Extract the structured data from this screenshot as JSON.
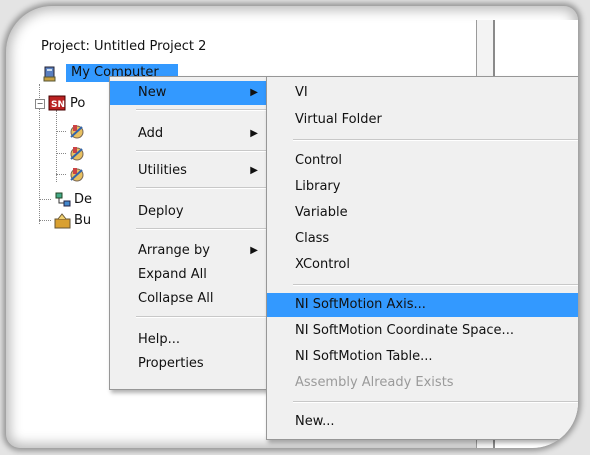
{
  "project": {
    "title": "Project: Untitled Project 2",
    "root_item": "My Computer",
    "child_items": [
      "Po",
      "De",
      "Bu"
    ]
  },
  "context_menu": {
    "items": [
      {
        "label": "New",
        "has_submenu": true,
        "highlighted": true
      },
      {
        "label": "Add",
        "has_submenu": true
      },
      {
        "label": "Utilities",
        "has_submenu": true
      },
      {
        "label": "Deploy",
        "has_submenu": false
      },
      {
        "label": "Arrange by",
        "has_submenu": true
      },
      {
        "label": "Expand All",
        "has_submenu": false
      },
      {
        "label": "Collapse All",
        "has_submenu": false
      },
      {
        "label": "Help...",
        "has_submenu": false
      },
      {
        "label": "Properties",
        "has_submenu": false
      }
    ]
  },
  "new_submenu": {
    "items": [
      {
        "label": "VI"
      },
      {
        "label": "Virtual Folder"
      },
      {
        "label": "Control"
      },
      {
        "label": "Library"
      },
      {
        "label": "Variable"
      },
      {
        "label": "Class"
      },
      {
        "label": "XControl"
      },
      {
        "label": "NI SoftMotion Axis...",
        "highlighted": true
      },
      {
        "label": "NI SoftMotion Coordinate Space..."
      },
      {
        "label": "NI SoftMotion Table..."
      },
      {
        "label": "Assembly Already Exists",
        "disabled": true
      },
      {
        "label": "New..."
      }
    ]
  },
  "colors": {
    "highlight": "#3399ff",
    "menu_bg": "#f0f0f0",
    "disabled_text": "#9a9a9a"
  }
}
